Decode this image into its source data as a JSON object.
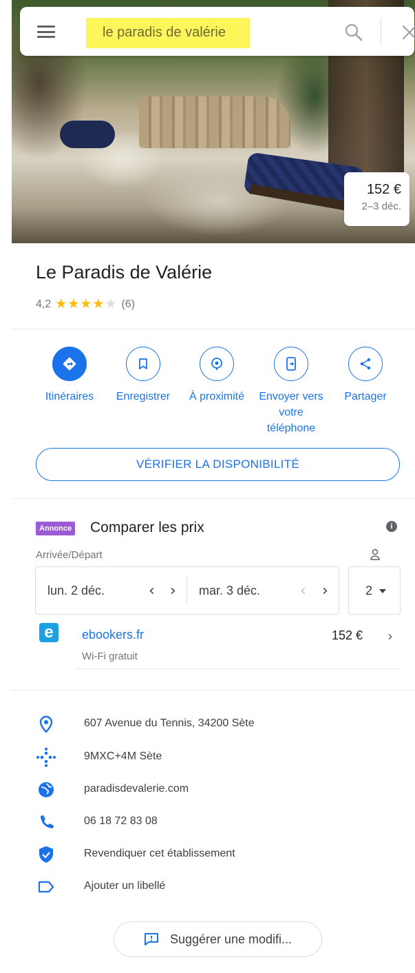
{
  "search": {
    "query": "le paradis de valérie"
  },
  "hero": {
    "price": "152 €",
    "dates": "2–3 déc."
  },
  "place": {
    "name": "Le Paradis de Valérie",
    "rating": "4,2",
    "stars_filled": 4,
    "stars_total": 5,
    "review_count": "(6)"
  },
  "actions": [
    {
      "label": "Itinéraires",
      "icon": "directions-icon"
    },
    {
      "label": "Enregistrer",
      "icon": "bookmark-icon"
    },
    {
      "label": "À proximité",
      "icon": "nearby-icon"
    },
    {
      "label": "Envoyer vers votre téléphone",
      "icon": "send-to-phone-icon"
    },
    {
      "label": "Partager",
      "icon": "share-icon"
    }
  ],
  "check_availability": "VÉRIFIER LA DISPONIBILITÉ",
  "compare": {
    "ad_label": "Annonce",
    "title": "Comparer les prix",
    "dates_label": "Arrivée/Départ",
    "checkin": "lun. 2 déc.",
    "checkout": "mar. 3 déc.",
    "guests": "2",
    "provider": {
      "logo_letter": "e",
      "name": "ebookers.fr",
      "feature": "Wi-Fi gratuit",
      "price": "152 €"
    }
  },
  "details": {
    "address": "607 Avenue du Tennis, 34200 Sète",
    "plus_code": "9MXC+4M Sète",
    "website": "paradisdevalerie.com",
    "phone": "06 18 72 83 08",
    "claim": "Revendiquer cet établissement",
    "label": "Ajouter un libellé"
  },
  "suggest_edit": "Suggérer une modifi...",
  "colors": {
    "accent": "#1a73e8",
    "star": "#fbbc04",
    "ad_badge": "#9c5bd4",
    "highlight": "#fdf65a"
  }
}
